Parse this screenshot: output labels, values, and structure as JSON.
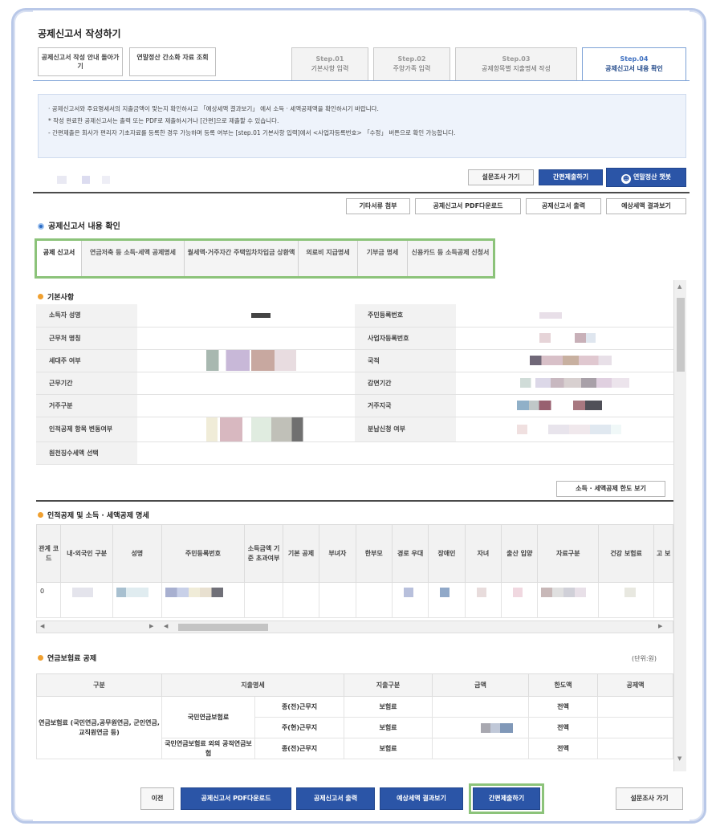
{
  "page_title": "공제신고서 작성하기",
  "top_buttons": [
    "공제신고서 작성 안내 돌아가기",
    "연말정산 간소화 자료 조회"
  ],
  "steps": [
    {
      "no": "Step.01",
      "label": "기본사항 입력"
    },
    {
      "no": "Step.02",
      "label": "주양가족 입력"
    },
    {
      "no": "Step.03",
      "label": "공제항목별 지출명세 작성"
    },
    {
      "no": "Step.04",
      "label": "공제신고서 내용 확인"
    }
  ],
  "notice": [
    "· 공제신고서와 주요명세서의 지출금액이 맞는지 확인하시고 「예상세액 결과보기」 에서 소득 · 세액공제액을 확인하시기 바랍니다.",
    "* 작성 완료한 공제신고서는 출력 또는 PDF로 제출하시거나 [간편]으로 제출할 수 있습니다.",
    " - 간편제출은 회사가 편리자 기초자료를 등록한 경우 가능하며 등록 여부는 [step.01 기본사항 입력]에서 <사업자등록번호> 「수정」 버튼으로 확인 가능합니다."
  ],
  "action_row1": [
    "설문조사 가기",
    "간편제출하기",
    "연말정산 챗봇"
  ],
  "action_row2": [
    "기타서류 첨부",
    "공제신고서 PDF다운로드",
    "공제신고서 출력",
    "예상세액 결과보기"
  ],
  "section_title": "공제신고서 내용 확인",
  "subtabs": [
    "공제 신고서",
    "연금저축 등 소득·세액 공제명세",
    "월세액·거주자간 주택임차차입금 상환액",
    "의료비 지급명세",
    "기부금 명세",
    "신용카드 등 소득공제 신청서"
  ],
  "basic": {
    "title": "기본사항",
    "rows": [
      [
        "소득자 성명",
        "주민등록번호"
      ],
      [
        "근무처 명칭",
        "사업자등록번호"
      ],
      [
        "세대주 여부",
        "국적"
      ],
      [
        "근무기간",
        "감면기간"
      ],
      [
        "거주구분",
        "거주지국"
      ],
      [
        "인적공제 항목 변동여부",
        "분납신청 여부"
      ],
      [
        "원천징수세액 선택",
        ""
      ]
    ],
    "detail_button": "소득 · 세액공제 한도 보기"
  },
  "personal": {
    "title": "인적공제 및 소득 · 세액공제 명세",
    "headers": [
      "관계 코드",
      "내·외국인 구분",
      "성명",
      "주민등록번호",
      "소득금액 기준 초과여부",
      "기본 공제",
      "부녀자",
      "한부모",
      "경로 우대",
      "장애인",
      "자녀",
      "출산 입양",
      "자료구분",
      "건강 보험료",
      "고 보"
    ],
    "first_code": "0"
  },
  "pension": {
    "title": "연금보험료 공제",
    "unit": "(단위:원)",
    "headers": [
      "구분",
      "지출명세",
      "지출구분",
      "금액",
      "한도액",
      "공제액"
    ],
    "group_label": "연금보험료 (국민연금,공무원연금, 군인연금,교직원연금 등)",
    "rows": [
      {
        "item": "국민연금보험료",
        "sub": "종(전)근무지",
        "type": "보험료",
        "limit": "전액"
      },
      {
        "item": "",
        "sub": "주(현)근무지",
        "type": "보험료",
        "limit": "전액"
      },
      {
        "item": "국민연금보험료 외의 공적연금보험",
        "sub": "종(전)근무지",
        "type": "보험료",
        "limit": "전액"
      }
    ]
  },
  "bottom_buttons": [
    "이전",
    "공제신고서 PDF다운로드",
    "공제신고서 출력",
    "예상세액 결과보기",
    "간편제출하기",
    "설문조사 가기"
  ]
}
